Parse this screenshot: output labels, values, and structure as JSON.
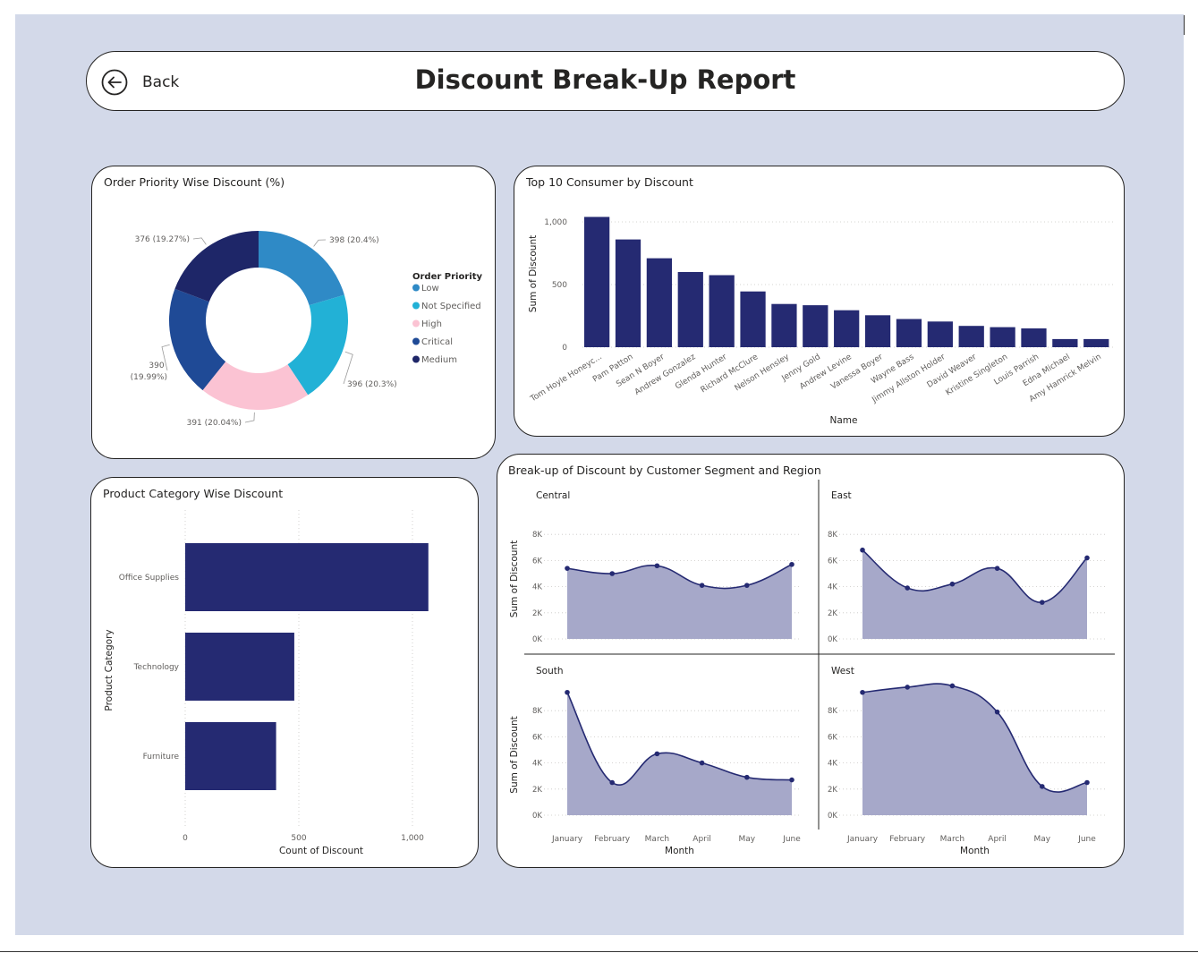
{
  "header": {
    "back_label": "Back",
    "title": "Discount Break-Up Report"
  },
  "colors": {
    "canvas": "#d3d9e9",
    "bar": "#252a72",
    "area_fill": "#a6a8c9",
    "line": "#252a72"
  },
  "chart_data": [
    {
      "id": "order-priority",
      "type": "pie",
      "title": "Order Priority Wise Discount (%)",
      "legend_title": "Order Priority",
      "legend_position": "right",
      "slices": [
        {
          "label": "Low",
          "value": 398,
          "pct": "20.4%",
          "data_label": "398 (20.4%)",
          "color": "#2f8ac6"
        },
        {
          "label": "Not Specified",
          "value": 396,
          "pct": "20.3%",
          "data_label": "396 (20.3%)",
          "color": "#22b1d6"
        },
        {
          "label": "High",
          "value": 391,
          "pct": "20.04%",
          "data_label": "391 (20.04%)",
          "color": "#fbc3d3"
        },
        {
          "label": "Critical",
          "value": 390,
          "pct": "19.99%",
          "data_label": [
            "390",
            "(19.99%)"
          ],
          "color": "#1f4a96"
        },
        {
          "label": "Medium",
          "value": 376,
          "pct": "19.27%",
          "data_label": "376 (19.27%)",
          "color": "#1e2668"
        }
      ]
    },
    {
      "id": "top-consumers",
      "type": "bar",
      "title": "Top 10 Consumer by Discount",
      "xlabel": "Name",
      "ylabel": "Sum of Discount",
      "ylim": [
        0,
        1100
      ],
      "yticks": [
        0,
        500,
        1000
      ],
      "ytick_labels": [
        "0",
        "500",
        "1,000"
      ],
      "grid": true,
      "categories": [
        "Tom Hoyle Honeyc...",
        "Pam Patton",
        "Sean N Boyer",
        "Andrew Gonzalez",
        "Glenda Hunter",
        "Richard McClure",
        "Nelson Hensley",
        "Jenny Gold",
        "Andrew Levine",
        "Vanessa Boyer",
        "Wayne Bass",
        "Jimmy Allston Holder",
        "David Weaver",
        "Kristine Singleton",
        "Louis Parrish",
        "Edna Michael",
        "Amy Hamrick Melvin"
      ],
      "values": [
        1040,
        860,
        710,
        600,
        575,
        445,
        345,
        335,
        295,
        255,
        225,
        205,
        170,
        160,
        150,
        65,
        65
      ]
    },
    {
      "id": "product-category",
      "type": "bar",
      "orientation": "horizontal",
      "title": "Product Category Wise Discount",
      "xlabel": "Count of Discount",
      "ylabel": "Product Category",
      "xlim": [
        0,
        1150
      ],
      "xticks": [
        0,
        500,
        1000
      ],
      "xtick_labels": [
        "0",
        "500",
        "1,000"
      ],
      "grid": true,
      "categories": [
        "Office Supplies",
        "Technology",
        "Furniture"
      ],
      "values": [
        1070,
        480,
        400
      ]
    },
    {
      "id": "segment-region",
      "type": "area",
      "title": "Break-up of Discount by Customer Segment and Region",
      "xlabel": "Month",
      "ylabel": "Sum of Discount",
      "ylim": [
        0,
        9500
      ],
      "yticks": [
        0,
        2000,
        4000,
        6000,
        8000
      ],
      "ytick_labels": [
        "0K",
        "2K",
        "4K",
        "6K",
        "8K"
      ],
      "x": [
        "January",
        "February",
        "March",
        "April",
        "May",
        "June"
      ],
      "panels": [
        {
          "name": "Central",
          "values": [
            5400,
            5000,
            5600,
            4100,
            4100,
            5700
          ]
        },
        {
          "name": "East",
          "values": [
            6800,
            3900,
            4200,
            5400,
            2800,
            6200
          ]
        },
        {
          "name": "South",
          "values": [
            9400,
            2500,
            4700,
            4000,
            2900,
            2700
          ]
        },
        {
          "name": "West",
          "values": [
            9400,
            9800,
            9900,
            7900,
            2200,
            2500
          ]
        }
      ]
    }
  ]
}
